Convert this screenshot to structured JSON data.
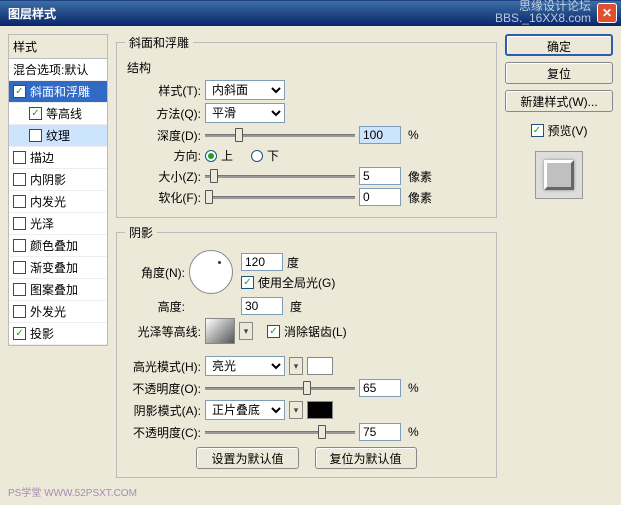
{
  "window": {
    "title": "图层样式",
    "watermark_line1": "思缘设计论坛",
    "watermark_line2": "BBS._16XX8.com",
    "footer_badge": "PS学堂  WWW.52PSXT.COM"
  },
  "sidebar": {
    "header": "样式",
    "blend_options": "混合选项:默认",
    "items": [
      {
        "label": "斜面和浮雕",
        "checked": true,
        "selected": true
      },
      {
        "label": "等高线",
        "checked": true,
        "sub": true
      },
      {
        "label": "纹理",
        "checked": false,
        "sub": true,
        "highlight": true
      },
      {
        "label": "描边",
        "checked": false
      },
      {
        "label": "内阴影",
        "checked": false
      },
      {
        "label": "内发光",
        "checked": false
      },
      {
        "label": "光泽",
        "checked": false
      },
      {
        "label": "颜色叠加",
        "checked": false
      },
      {
        "label": "渐变叠加",
        "checked": false
      },
      {
        "label": "图案叠加",
        "checked": false
      },
      {
        "label": "外发光",
        "checked": false
      },
      {
        "label": "投影",
        "checked": true
      }
    ]
  },
  "panel": {
    "title": "斜面和浮雕",
    "structure_header": "结构",
    "style_label": "样式(T):",
    "style_value": "内斜面",
    "technique_label": "方法(Q):",
    "technique_value": "平滑",
    "depth_label": "深度(D):",
    "depth_value": "100",
    "depth_unit": "%",
    "direction_label": "方向:",
    "dir_up": "上",
    "dir_down": "下",
    "size_label": "大小(Z):",
    "size_value": "5",
    "size_unit": "像素",
    "soften_label": "软化(F):",
    "soften_value": "0",
    "soften_unit": "像素",
    "shading_header": "阴影",
    "angle_label": "角度(N):",
    "angle_value": "120",
    "angle_unit": "度",
    "global_light": "使用全局光(G)",
    "altitude_label": "高度:",
    "altitude_value": "30",
    "altitude_unit": "度",
    "gloss_label": "光泽等高线:",
    "antialias": "消除锯齿(L)",
    "highlight_mode_label": "高光模式(H):",
    "highlight_mode_value": "亮光",
    "opacity_label1": "不透明度(O):",
    "highlight_opacity": "65",
    "shadow_mode_label": "阴影模式(A):",
    "shadow_mode_value": "正片叠底",
    "opacity_label2": "不透明度(C):",
    "shadow_opacity": "75",
    "pct": "%",
    "reset_default": "设置为默认值",
    "restore_default": "复位为默认值"
  },
  "buttons": {
    "ok": "确定",
    "cancel": "复位",
    "new_style": "新建样式(W)...",
    "preview": "预览(V)"
  }
}
